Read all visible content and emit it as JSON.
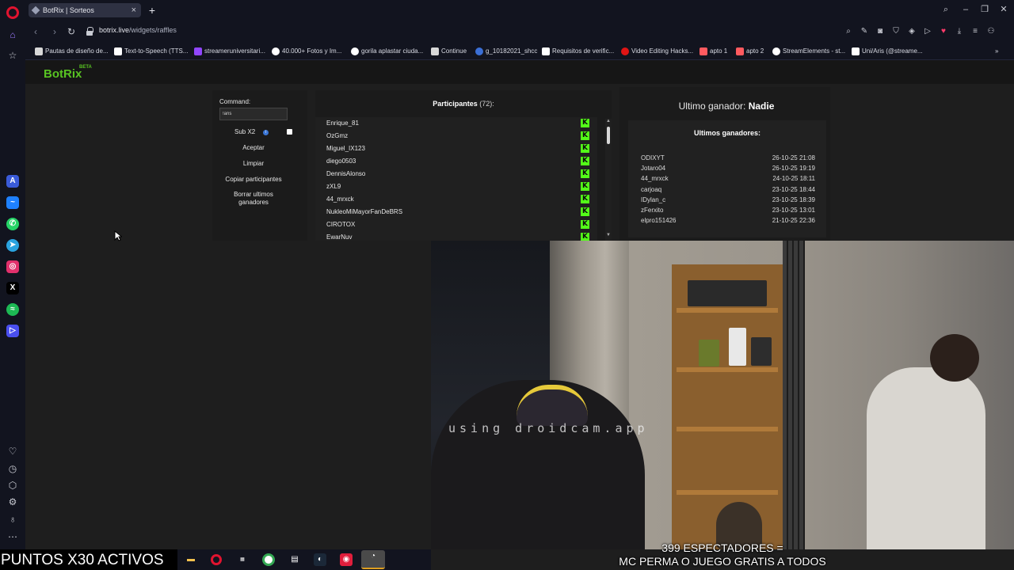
{
  "browser": {
    "tab_title": "BotRix | Sorteos",
    "tab_close": "×",
    "new_tab": "+",
    "url_host": "botrix.live",
    "url_path": "/widgets/raffles"
  },
  "bookmarks": [
    {
      "label": "Pautas de diseño de...",
      "color": "#d8d8d8"
    },
    {
      "label": "Text-to-Speech (TTS...",
      "color": "#ffffff"
    },
    {
      "label": "streameruniversitari...",
      "color": "#9146ff"
    },
    {
      "label": "40.000+ Fotos y Im...",
      "color": "#ffffff"
    },
    {
      "label": "gorila aplastar ciuda...",
      "color": "#ffffff"
    },
    {
      "label": "Continue",
      "color": "#d8d8d8"
    },
    {
      "label": "g_10182021_shcc",
      "color": "#3b6fd6"
    },
    {
      "label": "Requisitos de verific...",
      "color": "#ffffff"
    },
    {
      "label": "Video Editing Hacks...",
      "color": "#e01414"
    },
    {
      "label": "apto 1",
      "color": "#ff5a5f"
    },
    {
      "label": "apto 2",
      "color": "#ff5a5f"
    },
    {
      "label": "StreamElements - st...",
      "color": "#ffffff"
    },
    {
      "label": "Uni/Aris (@streame...",
      "color": "#ffffff"
    }
  ],
  "botrix": {
    "brand": "BotRix",
    "beta": "BETA",
    "command_label": "Command:",
    "command_value": "!aris",
    "sub_label": "Sub X2",
    "info": "i",
    "buttons": {
      "accept": "Aceptar",
      "clear": "Limpiar",
      "copy": "Copiar participantes",
      "delete": "Borrar ultimos ganadores"
    },
    "participants_title": "Participantes",
    "participants_count": "(72):",
    "participants": [
      "Enrique_81",
      "OzGmz",
      "Miguel_IX123",
      "diego0503",
      "DennisAlonso",
      "zXL9",
      "44_mrxck",
      "NukleoMiMayorFanDeBRS",
      "CIROTOX",
      "EwarNuv"
    ],
    "platform_icon": "K",
    "scroll_up": "▲",
    "scroll_down": "▼",
    "winner_label": "Ultimo ganador:",
    "winner_name": "Nadie",
    "last_winners_title": "Ultimos ganadores:",
    "last_winners": [
      {
        "name": "ODIXYT",
        "date": "26-10-25 21:08"
      },
      {
        "name": "Jotaro04",
        "date": "26-10-25 19:19"
      },
      {
        "name": "44_mrxck",
        "date": "24-10-25 18:11"
      },
      {
        "name": "carjoaq",
        "date": "23-10-25 18:44"
      },
      {
        "name": "IDylan_c",
        "date": "23-10-25 18:39"
      },
      {
        "name": "zFerxito",
        "date": "23-10-25 13:01"
      },
      {
        "name": "elpro151426",
        "date": "21-10-25 22:36"
      }
    ]
  },
  "webcam": {
    "watermark": "using droidcam.app"
  },
  "overlay": {
    "points": "PUNTOS X30 ACTIVOS",
    "viewers": "399 ESPECTADORES =",
    "promo": "MC PERMA O JUEGO GRATIS A TODOS"
  },
  "colors": {
    "accent": "#58c322",
    "kick": "#53fc18",
    "opera": "#e0132f"
  }
}
